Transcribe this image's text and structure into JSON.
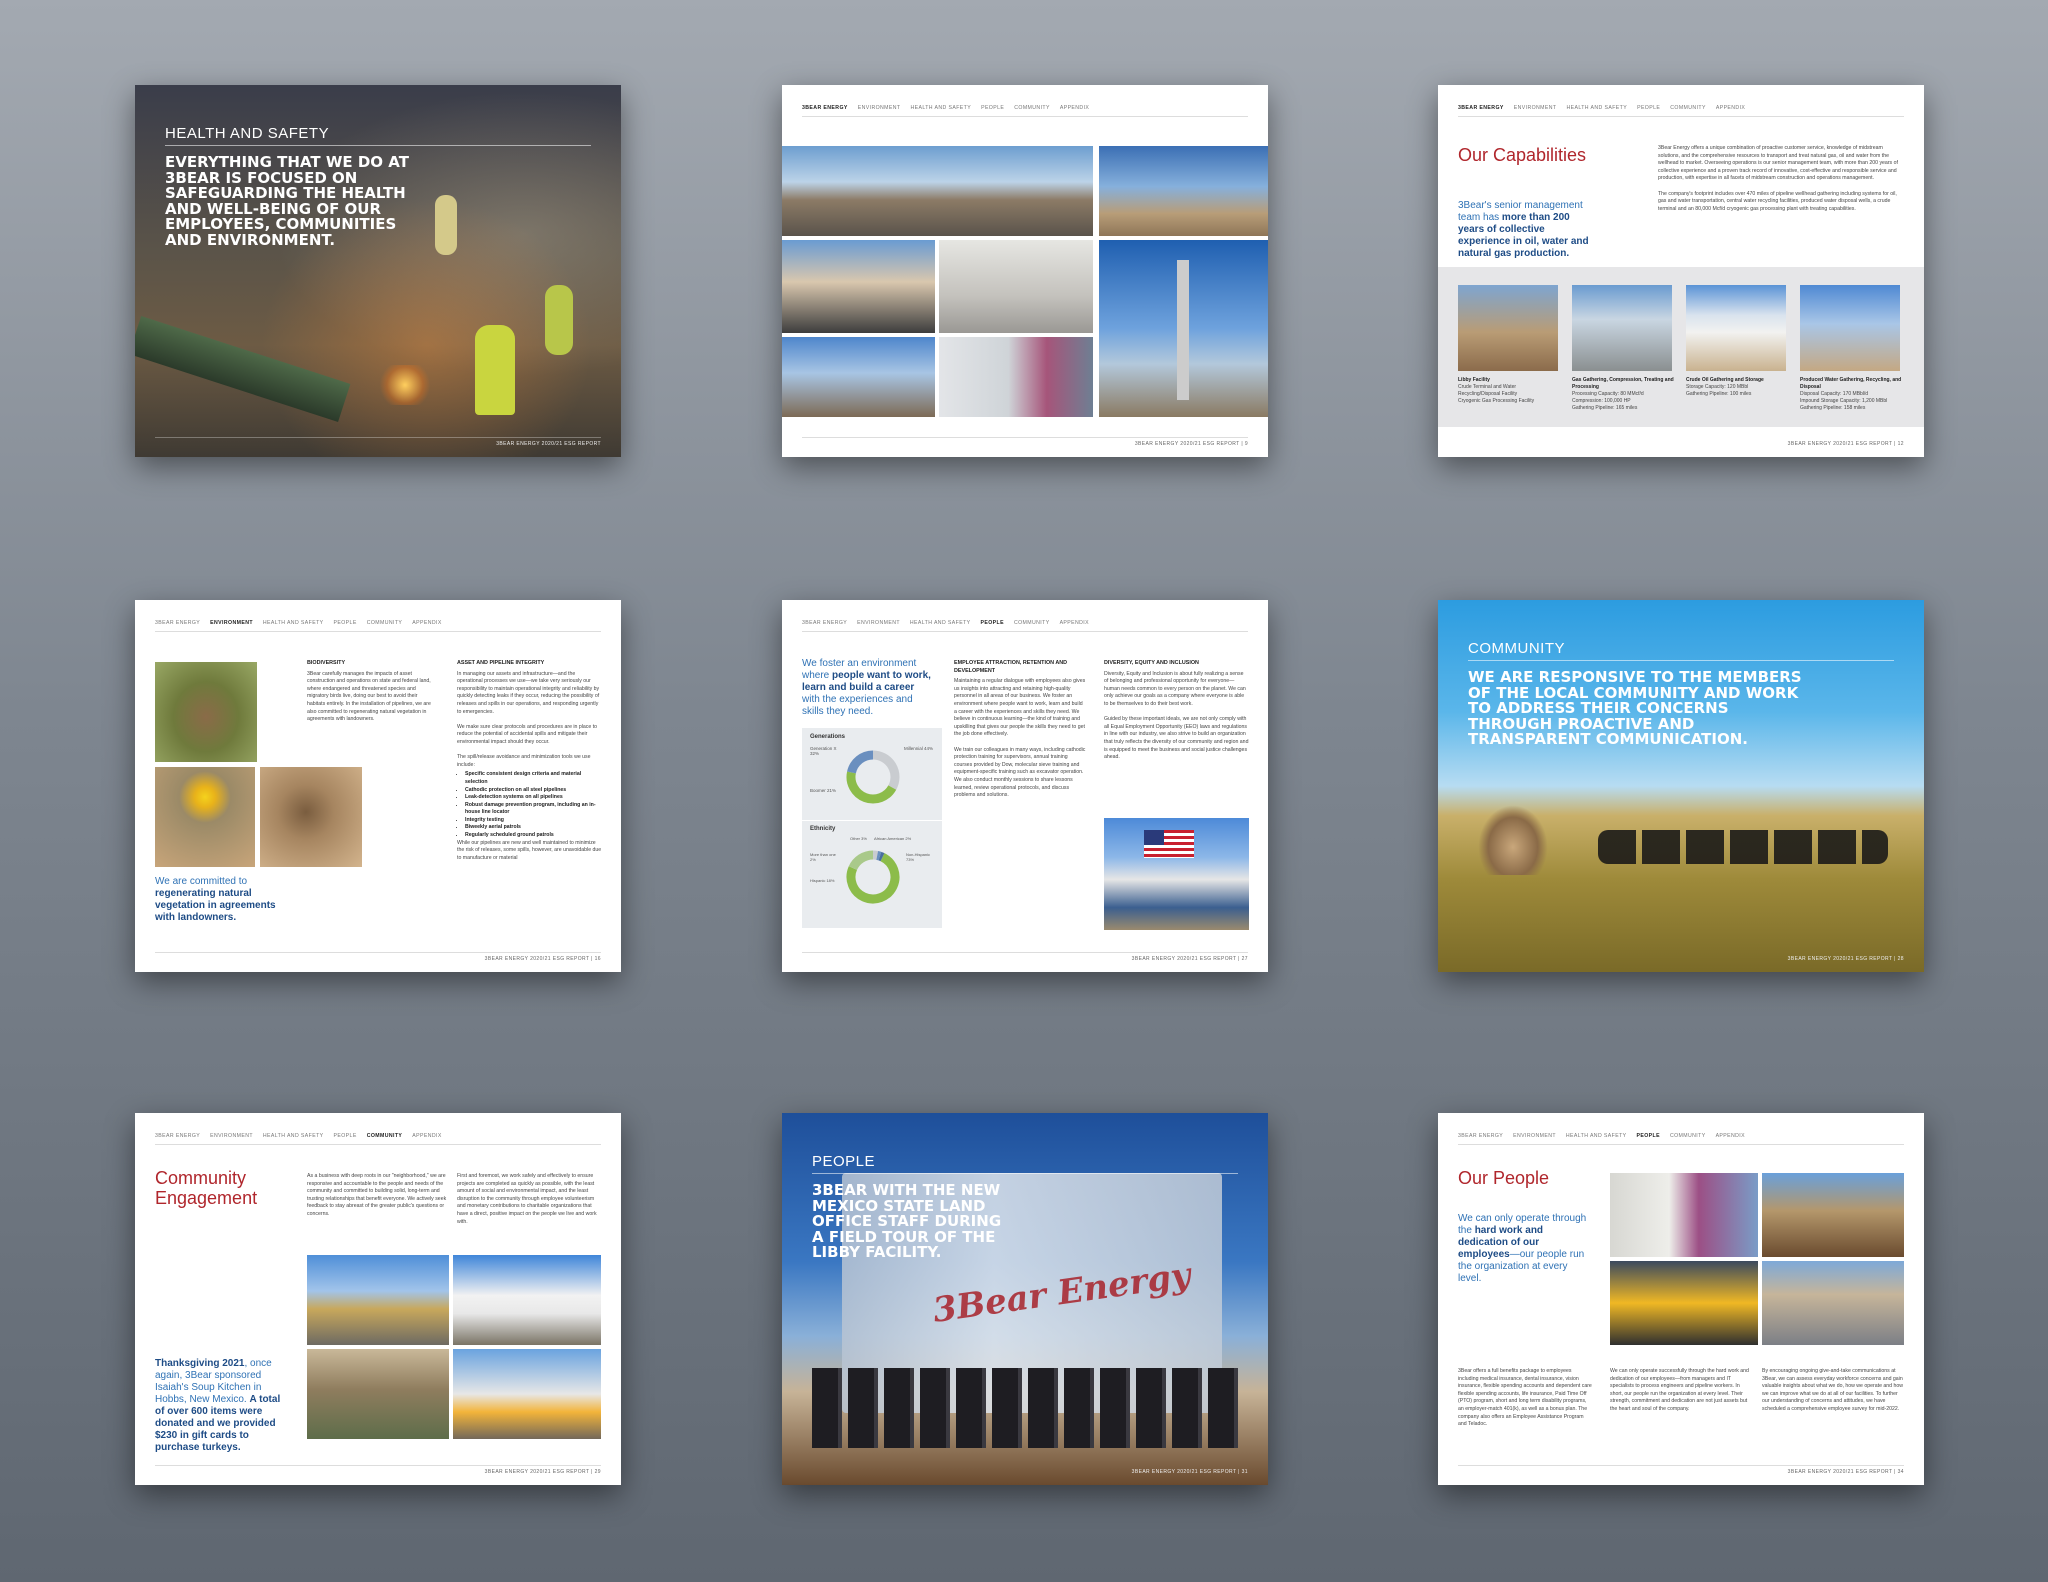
{
  "nav_items": [
    "3Bear Energy",
    "Environment",
    "Health and Safety",
    "People",
    "Community",
    "Appendix"
  ],
  "footer_text": "3Bear Energy 2020/21 ESG Report",
  "pages": {
    "health_safety": {
      "section": "Health and Safety",
      "headline": "Everything that we do at 3Bear is focused on safeguarding the health and well-being of our employees, communities and environment."
    },
    "capabilities": {
      "title": "Our Capabilities",
      "pull_plain": "3Bear's senior management team has ",
      "pull_bold": "more than 200 years of collective experience in oil, water and natural gas production.",
      "body": "3Bear Energy offers a unique combination of proactive customer service, knowledge of midstream solutions, and the comprehensive resources to transport and treat natural gas, oil and water from the wellhead to market. Overseeing operations is our senior management team, with more than 200 years of collective experience and a proven track record of innovative, cost-effective and responsible service and production, with expertise in all facets of midstream construction and operations management.",
      "body2": "The company's footprint includes over 470 miles of pipeline wellhead gathering including systems for oil, gas and water transportation, central water recycling facilities, produced water disposal wells, a crude terminal and an 80,000 Mcf/d cryogenic gas processing plant with treating capabilities.",
      "facilities": [
        {
          "name": "Libby Facility",
          "lines": [
            "Crude Terminal and Water",
            "Recycling/Disposal Facility",
            "Cryogenic Gas Processing Facility"
          ]
        },
        {
          "name": "Gas Gathering, Compression, Treating and Processing",
          "lines": [
            "Processing Capacity: 80 MMcf/d",
            "Compression: 100,000 HP",
            "Gathering Pipeline: 165 miles"
          ]
        },
        {
          "name": "Crude Oil Gathering and Storage",
          "lines": [
            "Storage Capacity: 120 MBbl",
            "Gathering Pipeline: 100 miles"
          ]
        },
        {
          "name": "Produced Water Gathering, Recycling, and Disposal",
          "lines": [
            "Disposal Capacity: 170 MBbl/d",
            "Impound Storage Capacity: 1,200 MBbl",
            "Gathering Pipeline: 158 miles"
          ]
        }
      ]
    },
    "environment": {
      "pull_plain": "We are committed to ",
      "pull_bold": "regenerating natural vegetation in agreements with landowners.",
      "biodiversity_title": "Biodiversity",
      "biodiversity_body": "3Bear carefully manages the impacts of asset construction and operations on state and federal land, where endangered and threatened species and migratory birds live, doing our best to avoid their habitats entirely. In the installation of pipelines, we are also committed to regenerating natural vegetation in agreements with landowners.",
      "integrity_title": "Asset and Pipeline Integrity",
      "integrity_body": "In managing our assets and infrastructure—and the operational processes we use—we take very seriously our responsibility to maintain operational integrity and reliability by quickly detecting leaks if they occur, reducing the possibility of releases and spills in our operations, and responding urgently to emergencies.",
      "integrity_body2": "We make sure clear protocols and procedures are in place to reduce the potential of accidental spills and mitigate their environmental impact should they occur.",
      "bullets_intro": "The spill/release avoidance and minimization tools we use include:",
      "bullets": [
        "Specific consistent design criteria and material selection",
        "Cathodic protection on all steel pipelines",
        "Leak-detection systems on all pipelines",
        "Robust damage prevention program, including an in-house line locator",
        "Integrity testing",
        "Biweekly aerial patrols",
        "Regularly scheduled ground patrols"
      ],
      "closing": "While our pipelines are new and well maintained to minimize the risk of releases, some spills, however, are unavoidable due to manufacture or material"
    },
    "people_stats": {
      "pull_plain1": "We foster an environment where ",
      "pull_bold": "people want to work, learn and build a career",
      "pull_plain2": " with the experiences and skills they need.",
      "gen_title": "Generations",
      "gen_labels": [
        "Generation X 32%",
        "Millennial 44%",
        "Boomer 21%"
      ],
      "eth_title": "Ethnicity",
      "eth_labels": [
        "Other 3%",
        "African American 2%",
        "More than one 2%",
        "Non-Hispanic 73%",
        "Hispanic 18%"
      ],
      "attraction_title": "Employee Attraction, Retention and Development",
      "attraction_body": "Maintaining a regular dialogue with employees also gives us insights into attracting and retaining high-quality personnel in all areas of our business. We foster an environment where people want to work, learn and build a career with the experiences and skills they need. We believe in continuous learning—the kind of training and upskilling that gives our people the skills they need to get the job done effectively.",
      "attraction_body2": "We train our colleagues in many ways, including cathodic protection training for supervisors, annual training courses provided by Dow, molecular sieve training and equipment-specific training such as excavator operation. We also conduct monthly sessions to share lessons learned, review operational protocols, and discuss problems and solutions.",
      "dei_title": "Diversity, Equity and Inclusion",
      "dei_body": "Diversity, Equity and Inclusion is about fully realizing a sense of belonging and professional opportunity for everyone—human needs common to every person on the planet. We can only achieve our goals as a company where everyone is able to be themselves to do their best work.",
      "dei_body2": "Guided by these important ideals, we are not only comply with all Equal Employment Opportunity (EEO) laws and regulations in line with our industry, we also strive to build an organization that truly reflects the diversity of our community and region and is equipped to meet the business and social justice challenges ahead."
    },
    "community_cover": {
      "section": "Community",
      "headline": "We are responsive to the members of the local community and work to address their concerns through proactive and transparent communication."
    },
    "community_engagement": {
      "title": "Community Engagement",
      "pull_bold1": "Thanksgiving 2021",
      "pull_plain": ", once again, 3Bear sponsored Isaiah's Soup Kitchen in Hobbs, New Mexico. ",
      "pull_bold2": "A total of over 600 items were donated and we provided $230 in gift cards to purchase turkeys.",
      "col1": "As a business with deep roots in our \"neighborhood,\" we are responsive and accountable to the people and needs of the community and committed to building solid, long-term and trusting relationships that benefit everyone. We actively seek feedback to stay abreast of the greater public's questions or concerns.",
      "col2": "First and foremost, we work safely and effectively to ensure projects are completed as quickly as possible, with the least amount of social and environmental impact, and the least disruption to the community through employee volunteerism and monetary contributions to charitable organizations that have a direct, positive impact on the people we live and work with."
    },
    "people_cover": {
      "section": "People",
      "headline": "3Bear with the New Mexico State Land Office staff during a field tour of the Libby Facility.",
      "tank_brand": "3Bear Energy"
    },
    "our_people": {
      "title": "Our People",
      "pull_plain1": "We can only operate through the ",
      "pull_bold": "hard work and dedication of our employees",
      "pull_plain2": "—our people run the organization at every level.",
      "col1": "3Bear offers a full benefits package to employees including medical insurance, dental insurance, vision insurance, flexible spending accounts and dependent care flexible spending accounts, life insurance, Paid Time Off (PTO) program, short and long term disability programs, an employer-match 401(k), as well as a bonus plan. The company also offers an Employee Assistance Program and Teladoc.",
      "col2": "We can only operate successfully through the hard work and dedication of our employees—from managers and IT specialists to process engineers and pipeline workers. In short, our people run the organization at every level. Their strength, commitment and dedication are not just assets but the heart and soul of the company.",
      "col3": "By encouraging ongoing give-and-take communications at 3Bear, we can assess everyday workforce concerns and gain valuable insights about what we do, how we operate and how we can improve what we do at all of our facilities. To further our understanding of concerns and attitudes, we have scheduled a comprehensive employee survey for mid-2022."
    }
  },
  "page_numbers": {
    "p2": "9",
    "p3": "12",
    "p4": "16",
    "p5": "27",
    "p6": "28",
    "p7": "29",
    "p8": "31",
    "p9": "34"
  },
  "colors": {
    "accent_red": "#b0262c",
    "accent_blue": "#2f72b5",
    "dark_blue": "#1e4c86",
    "donut_green": "#8cbc4a",
    "donut_blue": "#6a8fbf",
    "donut_gray": "#c9ccd0"
  },
  "people_stats_chart": {
    "generations": [
      {
        "label": "Generation X",
        "pct": 32
      },
      {
        "label": "Millennial",
        "pct": 44
      },
      {
        "label": "Boomer",
        "pct": 21
      }
    ],
    "ethnicity": [
      {
        "label": "Other",
        "pct": 3
      },
      {
        "label": "African American",
        "pct": 2
      },
      {
        "label": "More than one",
        "pct": 2
      },
      {
        "label": "Non-Hispanic",
        "pct": 73
      },
      {
        "label": "Hispanic",
        "pct": 18
      }
    ]
  }
}
